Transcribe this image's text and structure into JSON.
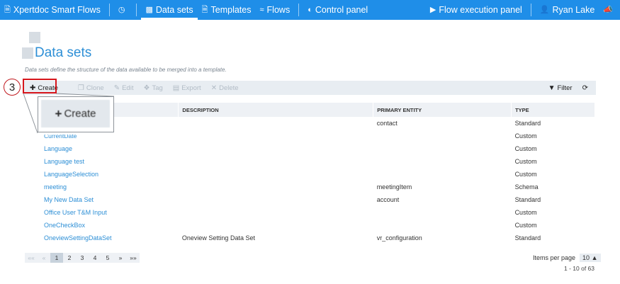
{
  "nav": {
    "brand": "Xpertdoc Smart Flows",
    "items": [
      {
        "icon": "dashboard-icon",
        "label": ""
      },
      {
        "icon": "data-sets-icon",
        "label": "Data sets",
        "active": true
      },
      {
        "icon": "templates-icon",
        "label": "Templates"
      },
      {
        "icon": "flows-icon",
        "label": "Flows"
      },
      {
        "icon": "control-panel-icon",
        "label": "Control panel"
      }
    ],
    "flow_execution": "Flow execution panel",
    "user": "Ryan Lake"
  },
  "page": {
    "title": "Data sets",
    "description": "Data sets define the structure of the data available to be merged into a template."
  },
  "toolbar": {
    "create": "Create",
    "clone": "Clone",
    "edit": "Edit",
    "tag": "Tag",
    "export": "Export",
    "delete": "Delete",
    "filter": "Filter"
  },
  "table": {
    "headers": [
      "",
      "DESCRIPTION",
      "PRIMARY ENTITY",
      "TYPE"
    ],
    "rows": [
      {
        "name": "",
        "description": "",
        "primary_entity": "contact",
        "type": "Standard"
      },
      {
        "name": "CurrentDate",
        "description": "",
        "primary_entity": "",
        "type": "Custom"
      },
      {
        "name": "Language",
        "description": "",
        "primary_entity": "",
        "type": "Custom"
      },
      {
        "name": "Language test",
        "description": "",
        "primary_entity": "",
        "type": "Custom"
      },
      {
        "name": "LanguageSelection",
        "description": "",
        "primary_entity": "",
        "type": "Custom"
      },
      {
        "name": "meeting",
        "description": "",
        "primary_entity": "meetingItem",
        "type": "Schema"
      },
      {
        "name": "My New Data Set",
        "description": "",
        "primary_entity": "account",
        "type": "Standard"
      },
      {
        "name": "Office User T&M Input",
        "description": "",
        "primary_entity": "",
        "type": "Custom"
      },
      {
        "name": "OneCheckBox",
        "description": "",
        "primary_entity": "",
        "type": "Custom"
      },
      {
        "name": "OneviewSettingDataSet",
        "description": "Oneview Setting Data Set",
        "primary_entity": "vr_configuration",
        "type": "Standard"
      }
    ]
  },
  "pager": {
    "first": "««",
    "prev": "«",
    "pages": [
      "1",
      "2",
      "3",
      "4",
      "5"
    ],
    "current": "1",
    "next": "»",
    "last": "»»",
    "items_per_page_label": "Items per page",
    "items_per_page": "10",
    "count": "1 - 10 of 63"
  },
  "tutorial": {
    "step": "3",
    "zoom_label": "Create"
  },
  "colors": {
    "nav_bg": "#1f8ee8",
    "link": "#2d8fd6",
    "highlight": "#d6161c"
  }
}
